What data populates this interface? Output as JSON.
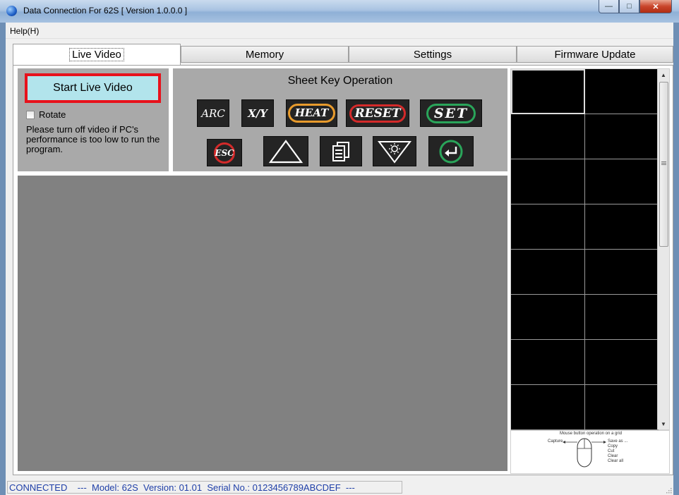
{
  "window": {
    "title": "Data Connection For 62S [ Version 1.0.0.0 ]"
  },
  "menu": {
    "help": "Help(H)"
  },
  "tabs": [
    "Live Video",
    "Memory",
    "Settings",
    "Firmware Update"
  ],
  "live_video": {
    "start_button": "Start Live Video",
    "rotate_label": "Rotate",
    "rotate_checked": false,
    "warning": "Please turn off video if PC's performance is too low to run the program."
  },
  "sheet_keys": {
    "title": "Sheet Key Operation",
    "row1": [
      "ARC",
      "X/Y",
      "HEAT",
      "RESET",
      "SET"
    ],
    "row2_icons": [
      "esc-icon",
      "triangle-up-icon",
      "copy-pages-icon",
      "brightness-icon",
      "enter-icon"
    ],
    "esc": "ESC"
  },
  "grid_help": {
    "title": "Mouse button operation on a grid",
    "left": "Capture",
    "right": [
      "Save as ...",
      "Copy",
      "Cut",
      "Clear",
      "Clear all"
    ]
  },
  "status": {
    "connection": "CONNECTED",
    "details": "---  Model: 62S  Version: 01.01  Serial No.: 0123456789ABCDEF  ---"
  },
  "colors": {
    "accent_red": "#e8111b",
    "start_bg": "#b2e4ec",
    "status_text": "#1f3fa8"
  }
}
